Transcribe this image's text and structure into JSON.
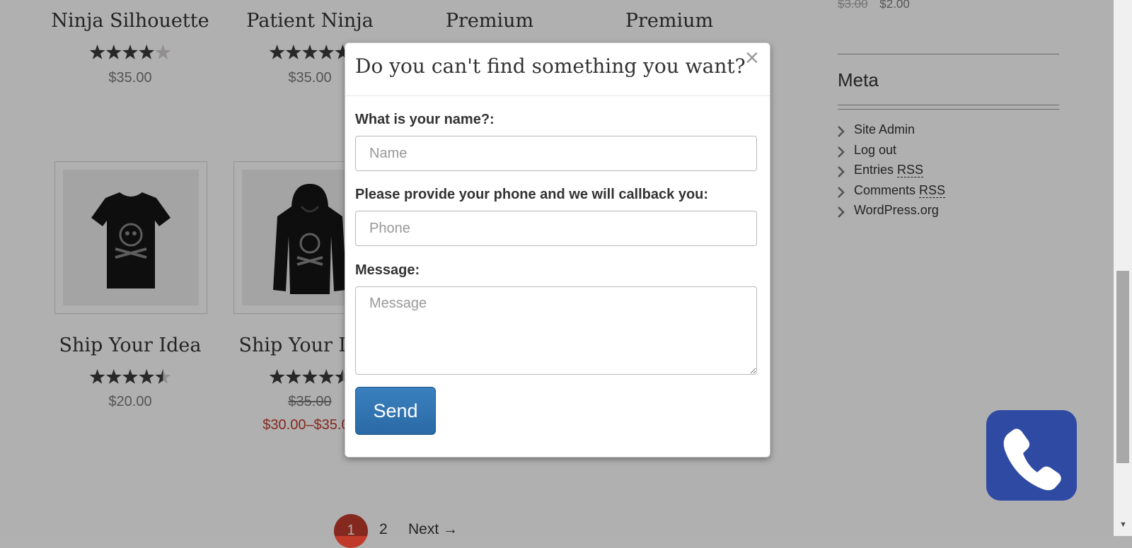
{
  "products_row1": [
    {
      "title": "Ninja Silhouette",
      "rating": 4,
      "price": "$35.00"
    },
    {
      "title": "Patient Ninja",
      "rating": 5,
      "price": "$35.00"
    },
    {
      "title": "Premium"
    },
    {
      "title": "Premium"
    }
  ],
  "products_row2": [
    {
      "title": "Ship Your Idea",
      "rating": 4.5,
      "price": "$20.00",
      "image": "tshirt"
    },
    {
      "title": "Ship Your Idea",
      "rating": 4.5,
      "old_price": "$35.00",
      "price_range": "$30.00–$35.00",
      "image": "hoodie"
    }
  ],
  "sidebar": {
    "top_old_price": "$3.00",
    "top_price": "$2.00",
    "meta_title": "Meta",
    "meta_items": [
      {
        "text": "Site Admin"
      },
      {
        "text": "Log out"
      },
      {
        "text": "Entries",
        "abbr": "RSS"
      },
      {
        "text": "Comments",
        "abbr": "RSS"
      },
      {
        "text": "WordPress.org"
      }
    ]
  },
  "pagination": {
    "current": "1",
    "page2": "2",
    "next": "Next →"
  },
  "modal": {
    "title": "Do you can't find something you want?",
    "close_symbol": "×",
    "name_label": "What is your name?:",
    "name_placeholder": "Name",
    "phone_label": "Please provide your phone and we will callback you:",
    "phone_placeholder": "Phone",
    "message_label": "Message:",
    "message_placeholder": "Message",
    "send_label": "Send"
  },
  "colors": {
    "accent_red": "#c13b2b",
    "send_button": "#2a6aa5",
    "phone_fab": "#2f4aa3",
    "overlay": "rgba(0,0,0,0.31)"
  },
  "icons": {
    "phone_fab": "phone-icon",
    "meta_bullet": "chevron-right-icon",
    "close": "close-icon"
  }
}
